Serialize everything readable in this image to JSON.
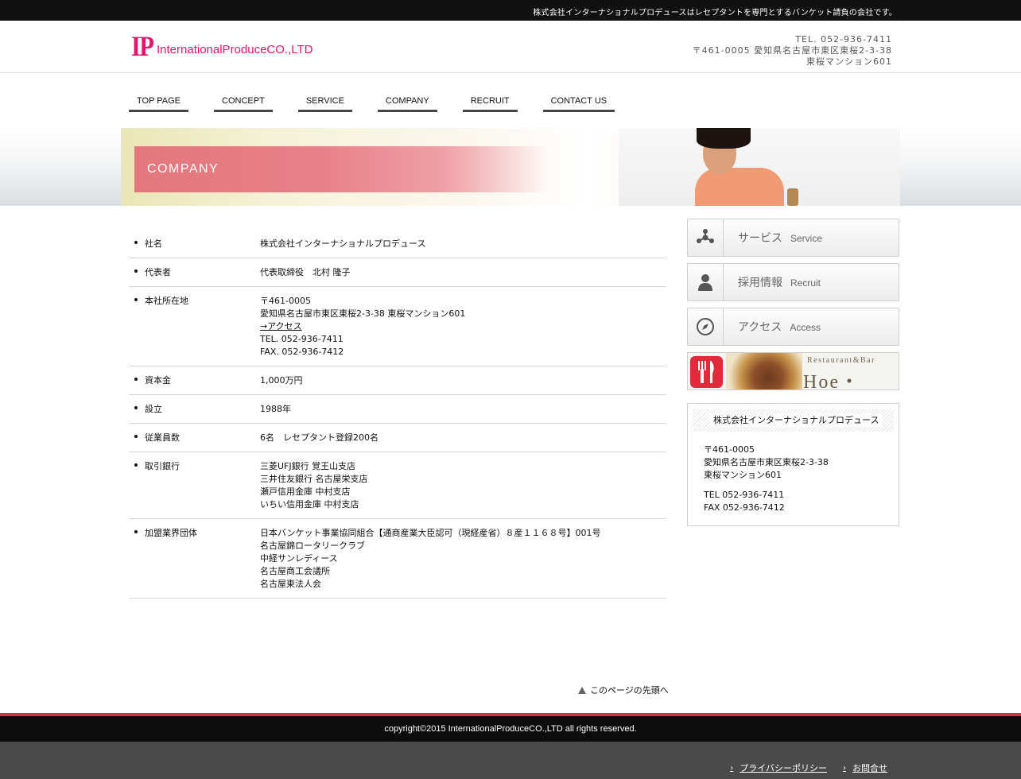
{
  "topbar": {
    "tagline": "株式会社インターナショナルプロデュースはレセプタントを専門とするバンケット請負の会社です。"
  },
  "header": {
    "logo_mark": "IP",
    "logo_name": "InternationalProduceCO.,LTD",
    "tel": "TEL. 052-936-7411",
    "address_line1": "〒461-0005 愛知県名古屋市東区東桜2-3-38",
    "address_line2": "東桜マンション601"
  },
  "nav": {
    "items": [
      "TOP PAGE",
      "CONCEPT",
      "SERVICE",
      "COMPANY",
      "RECRUIT",
      "CONTACT US"
    ]
  },
  "hero": {
    "title": "COMPANY"
  },
  "company_info": {
    "rows": [
      {
        "label": "社名",
        "lines": [
          "株式会社インターナショナルプロデュース"
        ]
      },
      {
        "label": "代表者",
        "lines": [
          "代表取締役　北村 隆子"
        ]
      },
      {
        "label": "本社所在地",
        "lines": [
          "〒461-0005",
          "愛知県名古屋市東区東桜2-3-38 東桜マンション601"
        ],
        "link": "→アクセス",
        "after_link": [
          "TEL. 052-936-7411",
          "FAX. 052-936-7412"
        ]
      },
      {
        "label": "資本金",
        "lines": [
          "1,000万円"
        ]
      },
      {
        "label": "設立",
        "lines": [
          "1988年"
        ]
      },
      {
        "label": "従業員数",
        "lines": [
          "6名　レセプタント登録200名"
        ]
      },
      {
        "label": "取引銀行",
        "lines": [
          "三菱UFJ銀行 覚王山支店",
          "三井住友銀行 名古屋栄支店",
          "瀬戸信用金庫 中村支店",
          "いちい信用金庫 中村支店"
        ]
      },
      {
        "label": "加盟業界団体",
        "lines": [
          "日本バンケット事業協同組合【通商産業大臣認可（現経産省）８産１１６８号】001号",
          "名古屋錦ロータリークラブ",
          "中経サンレディース",
          "名古屋商工会議所",
          "名古屋東法人会"
        ]
      }
    ]
  },
  "sidebar": {
    "buttons": [
      {
        "jp": "サービス",
        "en": "Service",
        "icon": "network-icon"
      },
      {
        "jp": "採用情報",
        "en": "Recruit",
        "icon": "person-icon"
      },
      {
        "jp": "アクセス",
        "en": "Access",
        "icon": "compass-icon"
      }
    ],
    "banner": {
      "sub": "Restaurant&Bar",
      "name": "Hoe・Ever"
    },
    "company_box": {
      "title": "株式会社インターナショナルプロデュース",
      "zip": "〒461-0005",
      "addr1": "愛知県名古屋市東区東桜2-3-38",
      "addr2": "東桜マンション601",
      "tel": "TEL 052-936-7411",
      "fax": "FAX 052-936-7412"
    }
  },
  "pagetop": {
    "label": "このページの先頭へ"
  },
  "footer": {
    "copyright": "copyright©2015 InternationalProduceCO.,LTD all rights reserved.",
    "links": [
      "プライバシーポリシー",
      "お問合せ"
    ]
  },
  "colors": {
    "brand": "#e0186c",
    "footer_accent": "#d0314c",
    "hero_band": "#e8808a"
  }
}
